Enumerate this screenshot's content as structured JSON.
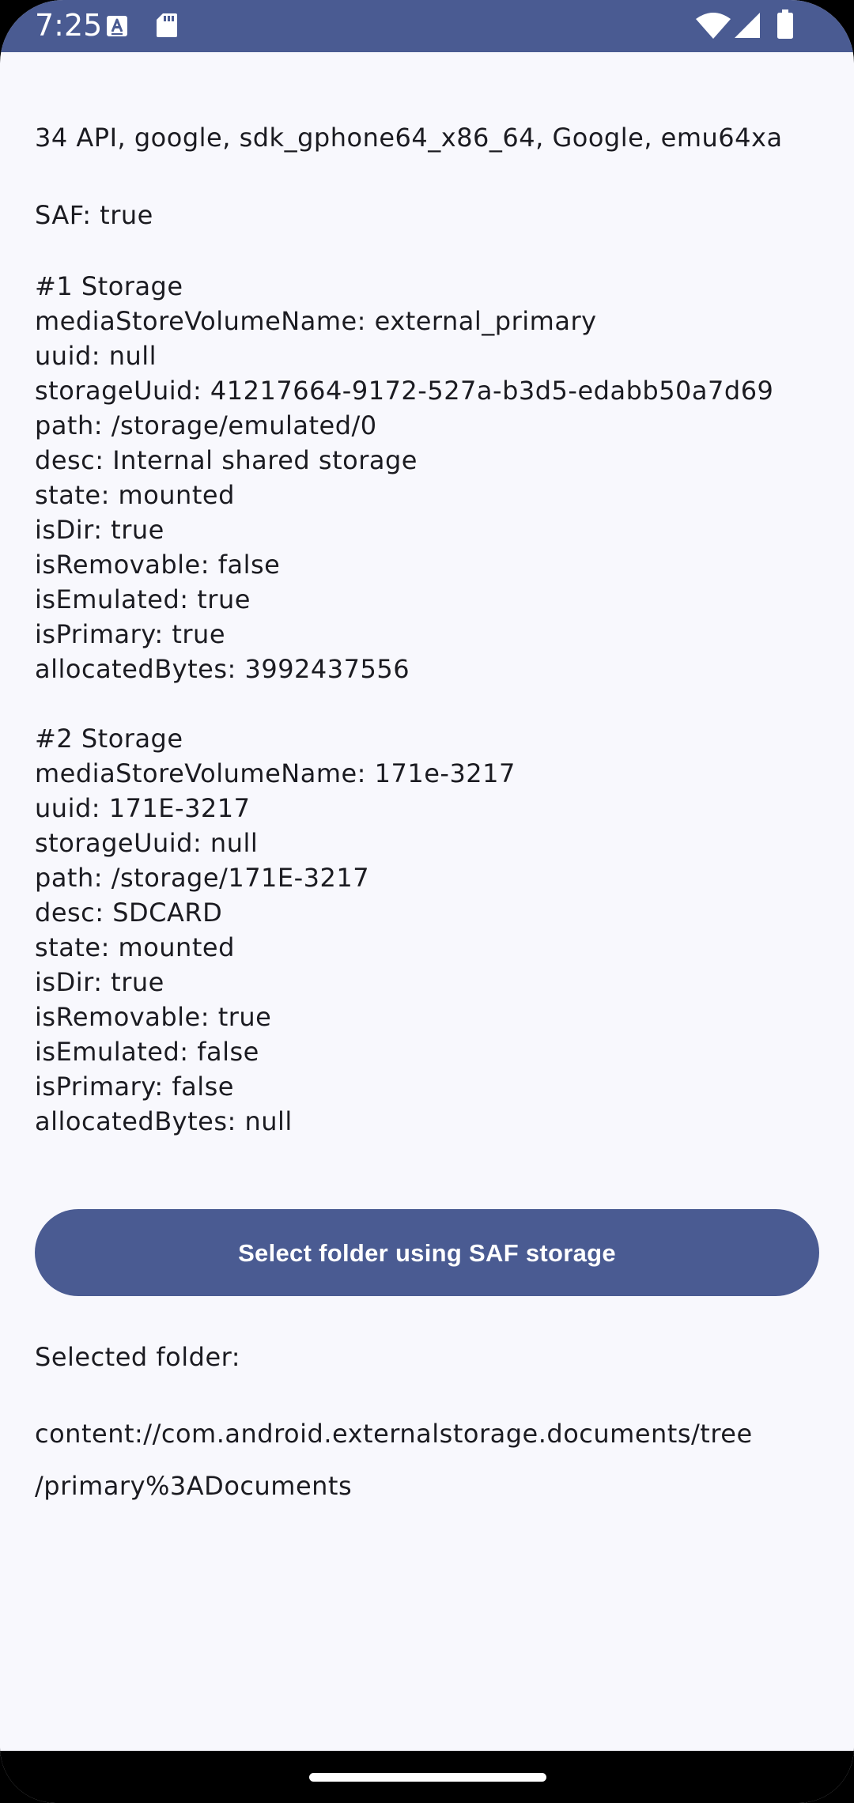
{
  "status_bar": {
    "time": "7:25",
    "background": "#4a5b92",
    "icons": [
      "text-format-icon",
      "sd-card-icon",
      "wifi-icon",
      "cellular-signal-icon",
      "battery-icon"
    ]
  },
  "device_info": "34 API, google, sdk_gphone64_x86_64, Google, emu64xa",
  "saf_status": "SAF: true",
  "storages": [
    {
      "lines": [
        "#1 Storage",
        "mediaStoreVolumeName: external_primary",
        "uuid: null",
        "storageUuid: 41217664-9172-527a-b3d5-edabb50a7d69",
        "path: /storage/emulated/0",
        "desc: Internal shared storage",
        "state: mounted",
        "isDir: true",
        "isRemovable: false",
        "isEmulated: true",
        "isPrimary: true",
        "allocatedBytes: 3992437556"
      ]
    },
    {
      "lines": [
        "#2 Storage",
        "mediaStoreVolumeName: 171e-3217",
        "uuid: 171E-3217",
        "storageUuid: null",
        "path: /storage/171E-3217",
        "desc: SDCARD",
        "state: mounted",
        "isDir: true",
        "isRemovable: true",
        "isEmulated: false",
        "isPrimary: false",
        "allocatedBytes: null"
      ]
    }
  ],
  "select_button_label": "Select folder using SAF storage",
  "selected_folder_label": "Selected folder:",
  "selected_folder_path": "content://com.android.externalstorage.documents/tree\n/primary%3ADocuments",
  "colors": {
    "accent": "#4a5b92",
    "background": "#f8f8fd",
    "text": "#1b1b21"
  }
}
